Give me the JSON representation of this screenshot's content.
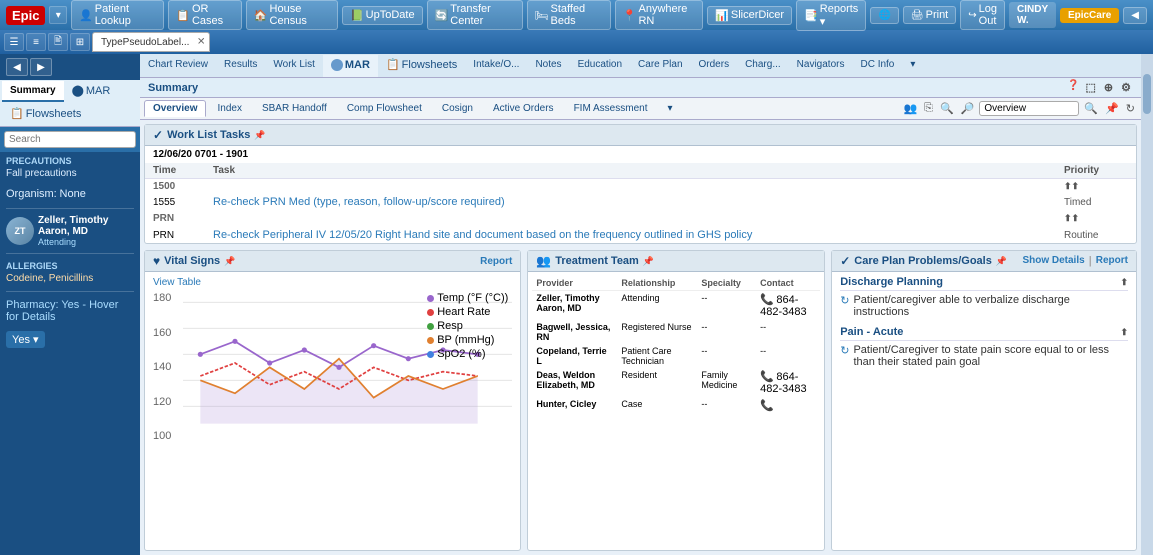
{
  "topBar": {
    "epicLabel": "Epic",
    "buttons": [
      {
        "label": "Patient Lookup",
        "icon": "👤"
      },
      {
        "label": "OR Cases",
        "icon": "📋"
      },
      {
        "label": "House Census",
        "icon": "🏠"
      },
      {
        "label": "UpToDate",
        "icon": "📗"
      },
      {
        "label": "Transfer Center",
        "icon": "🔄"
      },
      {
        "label": "Staffed Beds",
        "icon": "🛏"
      },
      {
        "label": "Anywhere RN",
        "icon": "📍"
      },
      {
        "label": "SlicerDicer",
        "icon": "📊"
      },
      {
        "label": "Reports ▾",
        "icon": "📑"
      }
    ],
    "rightButtons": [
      {
        "label": "Print"
      },
      {
        "label": "Log Out"
      }
    ],
    "userName": "CINDY W.",
    "appName": "EpicCare"
  },
  "tabBar": {
    "activeTab": "TypePseudoLabel...",
    "icons": [
      "☰",
      "📋",
      "🖹",
      "📐"
    ]
  },
  "navTabs": [
    {
      "label": "Summary",
      "active": true
    },
    {
      "label": "Chart Review"
    },
    {
      "label": "Results"
    },
    {
      "label": "Work List"
    },
    {
      "label": "MAR",
      "special": true
    },
    {
      "label": "Flowsheets",
      "special": true
    },
    {
      "label": "Intake/O..."
    },
    {
      "label": "Notes"
    },
    {
      "label": "Education"
    },
    {
      "label": "Care Plan"
    },
    {
      "label": "Orders"
    },
    {
      "label": "Charg..."
    },
    {
      "label": "Navigators"
    },
    {
      "label": "DC Info"
    }
  ],
  "summaryHeader": "Summary",
  "subToolbar": {
    "tabs": [
      {
        "label": "Overview",
        "active": true
      },
      {
        "label": "Index"
      },
      {
        "label": "SBAR Handoff"
      },
      {
        "label": "Comp Flowsheet"
      },
      {
        "label": "Cosign"
      },
      {
        "label": "Active Orders"
      },
      {
        "label": "FIM Assessment"
      },
      {
        "label": "▾"
      }
    ],
    "searchValue": "Overview"
  },
  "sidebar": {
    "searchPlaceholder": "Search",
    "precautionsTitle": "PRECAUTIONS",
    "fallPrecautions": "Fall precautions",
    "organismTitle": "Organism:",
    "organism": "None",
    "doctor": {
      "name": "Zeller, Timothy Aaron, MD",
      "role": "Attending",
      "initials": "ZT"
    },
    "allergiesTitle": "ALLERGIES",
    "allergies": "Codeine, Penicillins",
    "pharmacyLabel": "Pharmacy:",
    "pharmacyValue": "Yes - Hover for Details",
    "bottomLabel": "Yes"
  },
  "workListTasks": {
    "title": "Work List Tasks",
    "titleIcon": "✓",
    "dateRange": "12/06/20 0701 - 1901",
    "headers": [
      "Time",
      "Task",
      "",
      "Priority"
    ],
    "rows": [
      {
        "time": "1500",
        "task": "",
        "priority": "",
        "isHeader": true
      },
      {
        "time": "1555",
        "task": "Re-check PRN Med (type, reason, follow-up/score required)",
        "priority": "Timed",
        "isLink": true
      },
      {
        "time": "PRN",
        "task": "",
        "priority": "",
        "isHeader": true
      },
      {
        "time": "PRN",
        "task": "Re-check Peripheral IV 12/05/20 Right Hand site and document based on the frequency outlined in GHS policy",
        "priority": "Routine",
        "isLink": true
      }
    ]
  },
  "vitalSigns": {
    "title": "Vital Signs",
    "titleIcon": "♥",
    "reportLink": "Report",
    "viewTableLink": "View Table",
    "yAxisLabels": [
      "180",
      "160",
      "140",
      "120",
      "100"
    ],
    "legend": [
      {
        "label": "Temp (°F (°C))",
        "color": "#9966cc"
      },
      {
        "label": "Heart Rate",
        "color": "#e04040"
      },
      {
        "label": "Resp",
        "color": "#40a040"
      },
      {
        "label": "BP (mmHg)",
        "color": "#e08030"
      },
      {
        "label": "SpO2 (%)",
        "color": "#4080e0"
      }
    ],
    "chartData": {
      "tempPoints": "40,45 80,30 120,55 160,40 200,60 240,35 280,50 320,40",
      "hrPoints": "40,70 80,55 120,80 160,65 200,85 240,60 280,75 320,65",
      "bpPoints": "40,60 80,50 120,65 160,55 200,70 240,48 280,62 320,52"
    }
  },
  "treatmentTeam": {
    "title": "Treatment Team",
    "titleIcon": "👥",
    "headers": [
      "Provider",
      "Relationship",
      "Specialty",
      "Contact"
    ],
    "members": [
      {
        "name": "Zeller, Timothy Aaron, MD",
        "relationship": "Attending",
        "specialty": "--",
        "contact": "864-482-3483"
      },
      {
        "name": "Bagwell, Jessica, RN",
        "relationship": "Registered Nurse",
        "specialty": "--",
        "contact": "--"
      },
      {
        "name": "Copeland, Terrie L",
        "relationship": "Patient Care Technician",
        "specialty": "--",
        "contact": "--"
      },
      {
        "name": "Deas, Weldon Elizabeth, MD",
        "relationship": "Resident",
        "specialty": "Family Medicine",
        "contact": "864-482-3483"
      },
      {
        "name": "Hunter, Cicley",
        "relationship": "Case",
        "specialty": "--",
        "contact": "📞"
      }
    ]
  },
  "carePlan": {
    "title": "Care Plan Problems/Goals",
    "titleIcon": "✓",
    "showDetailsLink": "Show Details",
    "reportLink": "Report",
    "sections": [
      {
        "title": "Discharge Planning",
        "items": [
          "Patient/caregiver able to verbalize discharge instructions"
        ]
      },
      {
        "title": "Pain - Acute",
        "items": [
          "Patient/Caregiver to state pain score equal to or less than their stated pain goal"
        ]
      }
    ]
  }
}
